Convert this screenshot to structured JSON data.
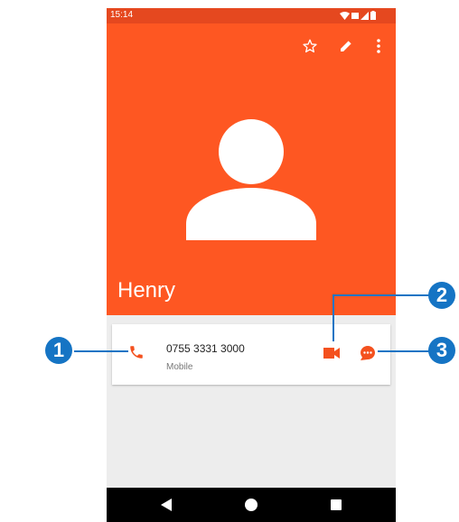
{
  "status_bar": {
    "time": "15:14"
  },
  "contact": {
    "name": "Henry",
    "number": "0755 3331 3000",
    "number_type": "Mobile"
  },
  "header_actions": {
    "favorite": "star-outline-icon",
    "edit": "pencil-icon",
    "more": "more-vert-icon"
  },
  "callouts": [
    "1",
    "2",
    "3"
  ],
  "colors": {
    "accent": "#fe5722",
    "status_bar": "#e5481f",
    "callout": "#1574c4",
    "card_icon": "#f4511e"
  }
}
